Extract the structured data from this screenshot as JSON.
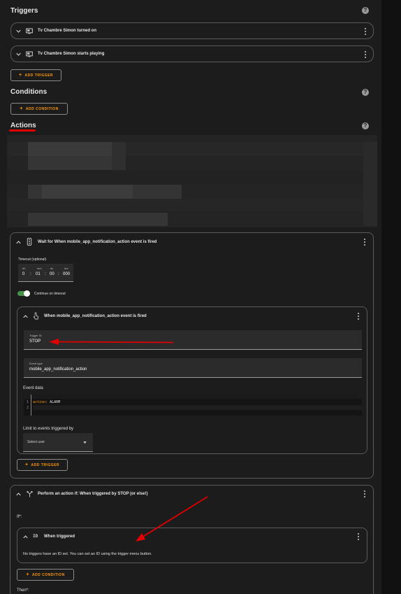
{
  "triggers": {
    "title": "Triggers",
    "items": [
      {
        "label": "Tv Chambre Simon turned on"
      },
      {
        "label": "Tv Chambre Simon starts playing"
      }
    ],
    "add_button": "ADD TRIGGER"
  },
  "conditions": {
    "title": "Conditions",
    "add_button": "ADD CONDITION"
  },
  "actions": {
    "title": "Actions",
    "wait_card": {
      "title": "Wait for When mobile_app_notification_action event is fired",
      "timeout_label": "Timeout (optional)",
      "timeout": {
        "hh_label": "hh",
        "mm_label": "mm",
        "ss_label": "ss",
        "ms_label": "ms",
        "hh": "0",
        "mm": "01",
        "ss": "00",
        "ms": "000",
        "sep1": ":",
        "sep2": ":",
        "sep3": ":"
      },
      "continue_label": "Continue on timeout",
      "inner_trigger": {
        "title": "When mobile_app_notification_action event is fired",
        "trigger_id_label": "Trigger ID",
        "trigger_id_value": "STOP",
        "event_type_label": "Event type",
        "event_type_value": "mobile_app_notification_action",
        "event_data_label": "Event data",
        "code_line1_num": "1",
        "code_line1_key": "action",
        "code_line1_sep": ":",
        "code_line1_val": "ALARM",
        "code_line2_num": "2",
        "limit_label": "Limit to events triggered by",
        "select_user_placeholder": "Select user"
      },
      "add_trigger_button": "ADD TRIGGER"
    },
    "if_card": {
      "title": "Perform an action if: When triggered by STOP (or else!)",
      "if_label": "If*:",
      "condition_title": "When triggered",
      "condition_text": "No triggers have an ID set. You can set an ID using the trigger menu button.",
      "add_condition_button": "ADD CONDITION",
      "then_label": "Then*:"
    }
  },
  "colors": {
    "accent": "#ff9800",
    "toggle": "#4caf50",
    "annotation": "#e30000",
    "background": "#1c1c1c"
  }
}
